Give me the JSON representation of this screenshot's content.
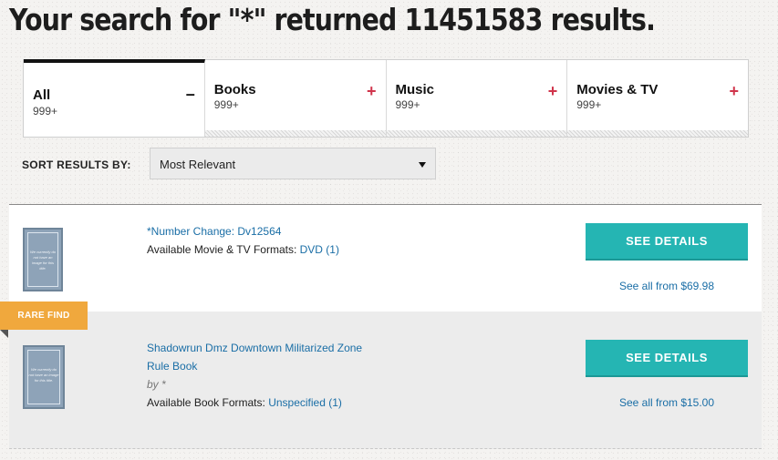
{
  "header": {
    "title": "Your search for \"*\" returned 11451583 results."
  },
  "tabs": [
    {
      "label": "All",
      "count": "999+",
      "toggle": "–",
      "active": true
    },
    {
      "label": "Books",
      "count": "999+",
      "toggle": "+",
      "active": false
    },
    {
      "label": "Music",
      "count": "999+",
      "toggle": "+",
      "active": false
    },
    {
      "label": "Movies & TV",
      "count": "999+",
      "toggle": "+",
      "active": false
    }
  ],
  "sort": {
    "label": "SORT RESULTS BY:",
    "value": "Most Relevant"
  },
  "results": [
    {
      "title": "*Number Change: Dv12564",
      "cover_text": "We currently do not have an image for this title.",
      "formats_label": "Available Movie & TV Formats:",
      "format_link": "DVD (1)",
      "button": "SEE DETAILS",
      "see_all": "See all from $69.98"
    },
    {
      "badge": "RARE FIND",
      "title": "Shadowrun Dmz Downtown Militarized Zone Rule Book",
      "cover_text": "We currently do not have an image for this title.",
      "byline": "by *",
      "formats_label": "Available Book Formats:",
      "format_link": "Unspecified (1)",
      "button": "SEE DETAILS",
      "see_all": "See all from $15.00"
    }
  ],
  "colors": {
    "accent": "#25b5b3",
    "link": "#1a6ea6",
    "badge": "#f0a83d",
    "toggle": "#d0344b"
  }
}
